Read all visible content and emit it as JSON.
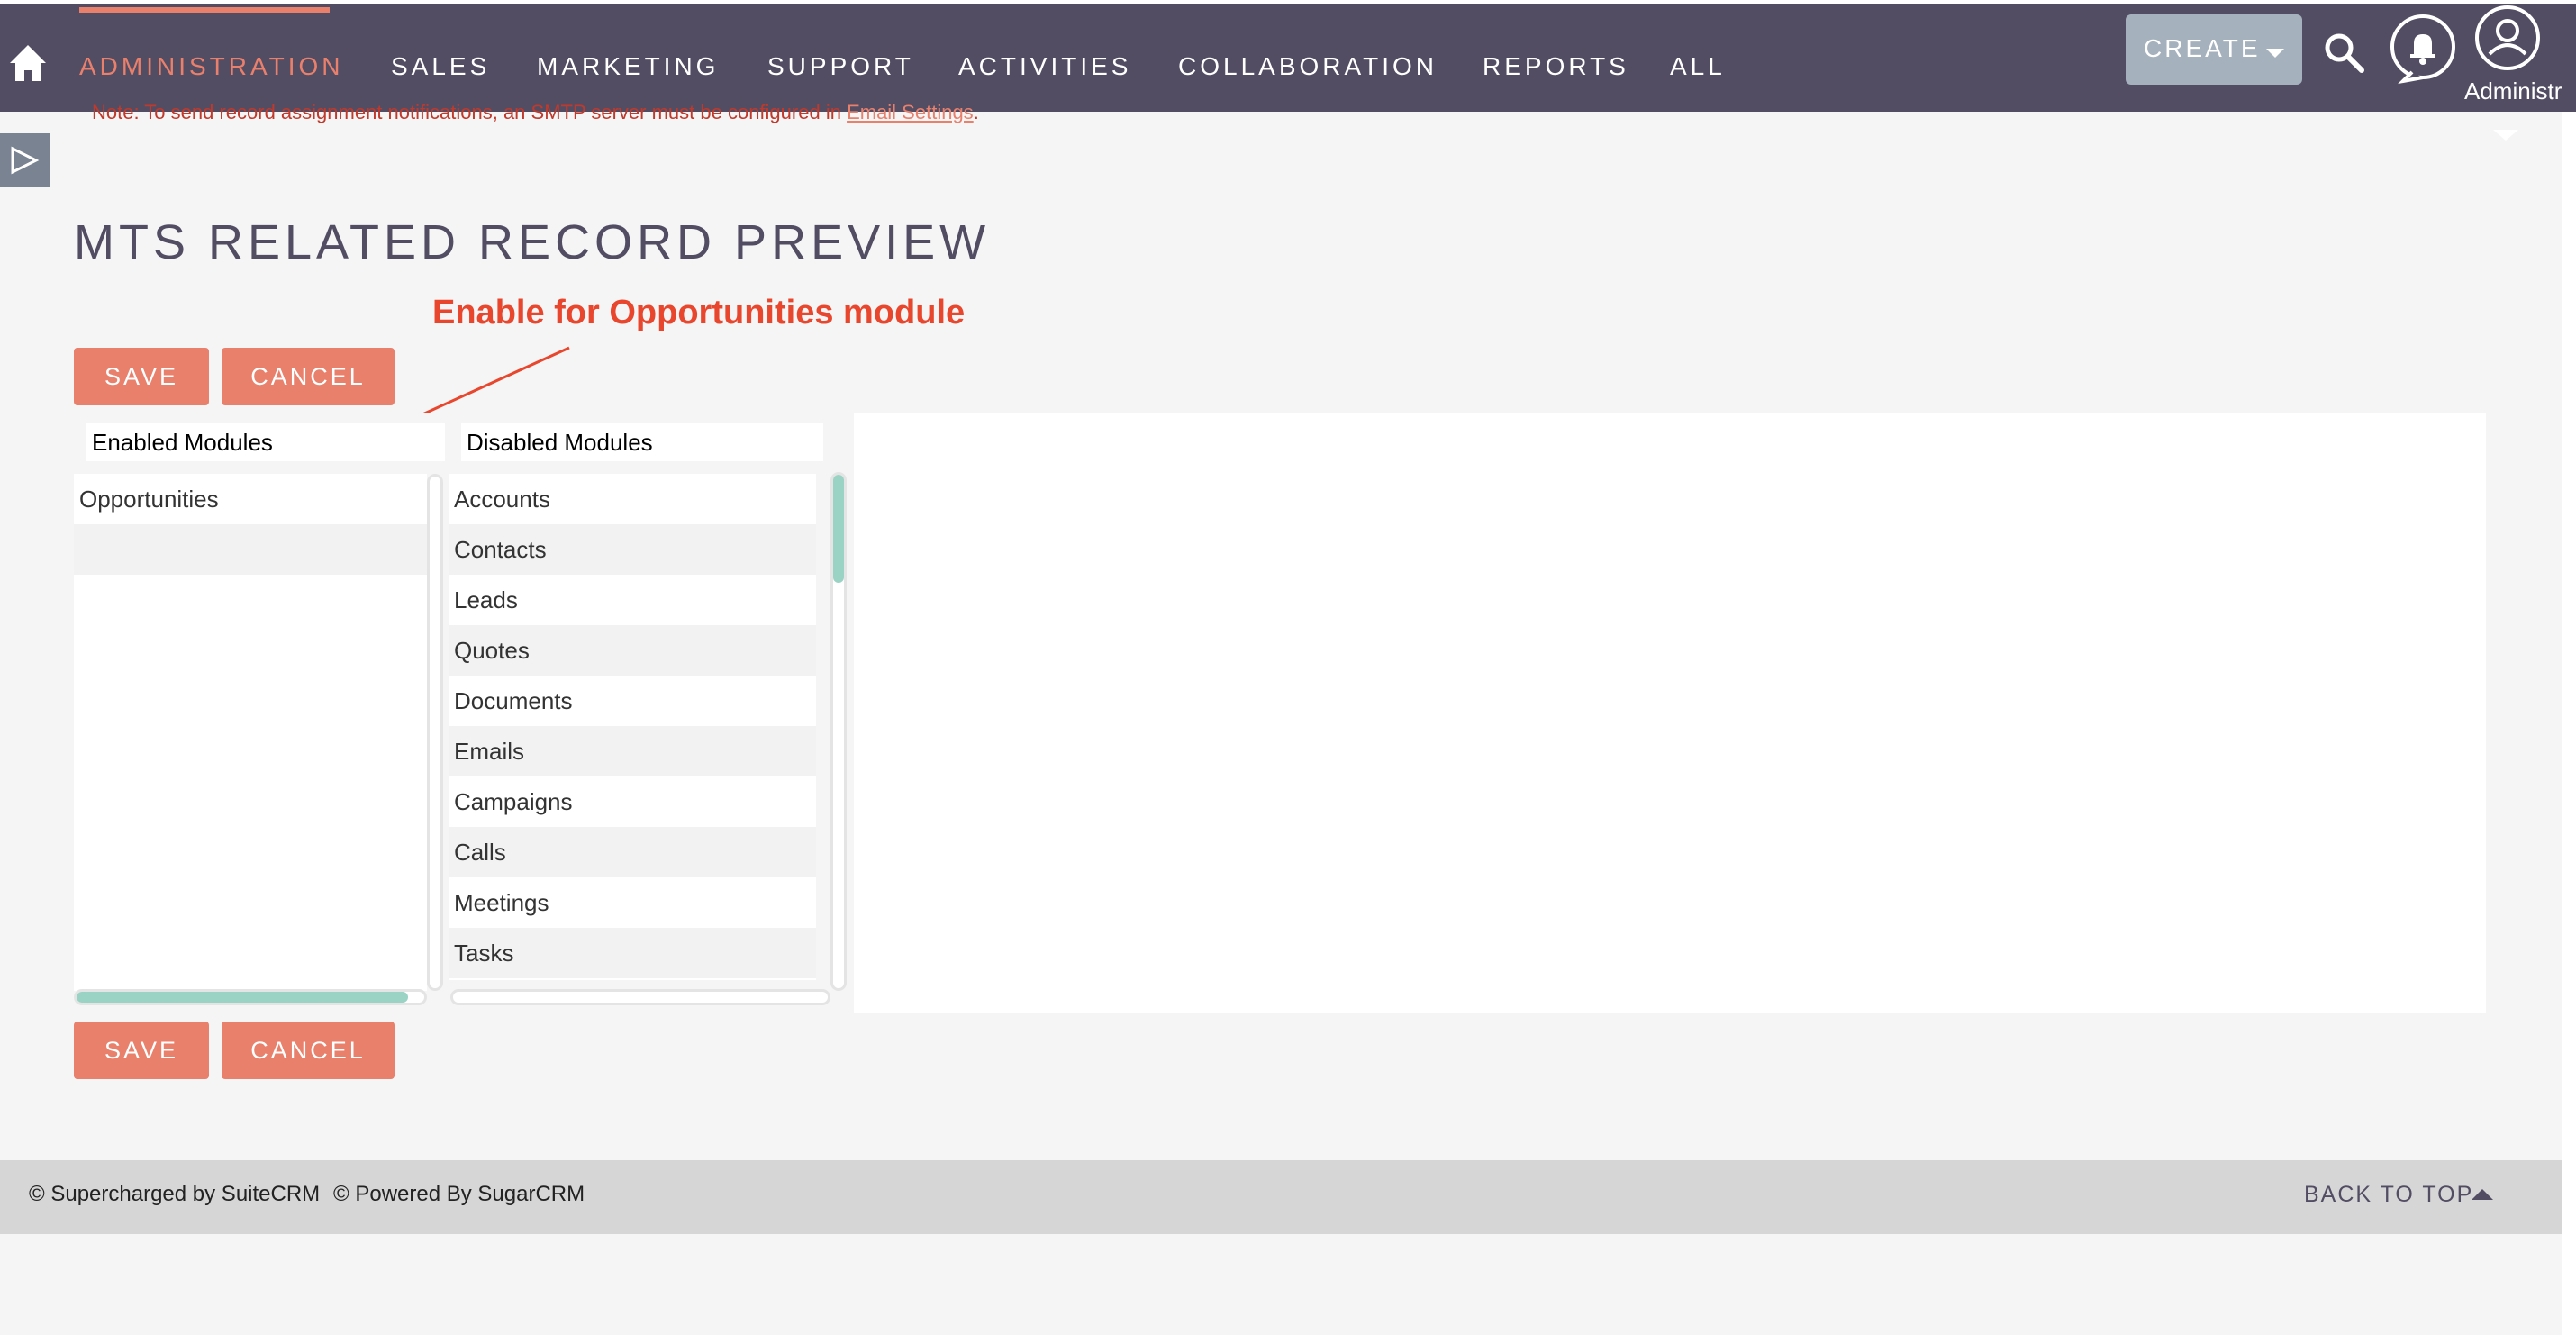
{
  "nav": {
    "tabs": [
      {
        "label": "ADMINISTRATION"
      },
      {
        "label": "SALES"
      },
      {
        "label": "MARKETING"
      },
      {
        "label": "SUPPORT"
      },
      {
        "label": "ACTIVITIES"
      },
      {
        "label": "COLLABORATION"
      },
      {
        "label": "REPORTS"
      },
      {
        "label": "ALL"
      }
    ],
    "active_tab": "ADMINISTRATION",
    "create_label": "CREATE",
    "user_label": "Administr",
    "icons": [
      "home-icon",
      "search-icon",
      "notification-bell-icon",
      "user-avatar-icon"
    ]
  },
  "notice": {
    "text": "Note: To send record assignment notifications, an SMTP server must be configured in ",
    "link": "Email Settings",
    "suffix": "."
  },
  "page": {
    "title": "MTS RELATED RECORD PREVIEW",
    "annotation": "Enable for Opportunities module"
  },
  "actions": {
    "save_label": "SAVE",
    "cancel_label": "CANCEL"
  },
  "modules": {
    "enabled_header": "Enabled Modules",
    "disabled_header": "Disabled Modules",
    "enabled": [
      "Opportunities"
    ],
    "disabled": [
      "Accounts",
      "Contacts",
      "Leads",
      "Quotes",
      "Documents",
      "Emails",
      "Campaigns",
      "Calls",
      "Meetings",
      "Tasks"
    ]
  },
  "footer": {
    "supercharged": "© Supercharged by SuiteCRM",
    "powered": "© Powered By SugarCRM",
    "back_to_top": "BACK TO TOP"
  },
  "colors": {
    "nav_bg": "#534d64",
    "accent": "#e8806c",
    "annotation": "#e8472e",
    "scroll_thumb": "#9ad3c3"
  }
}
